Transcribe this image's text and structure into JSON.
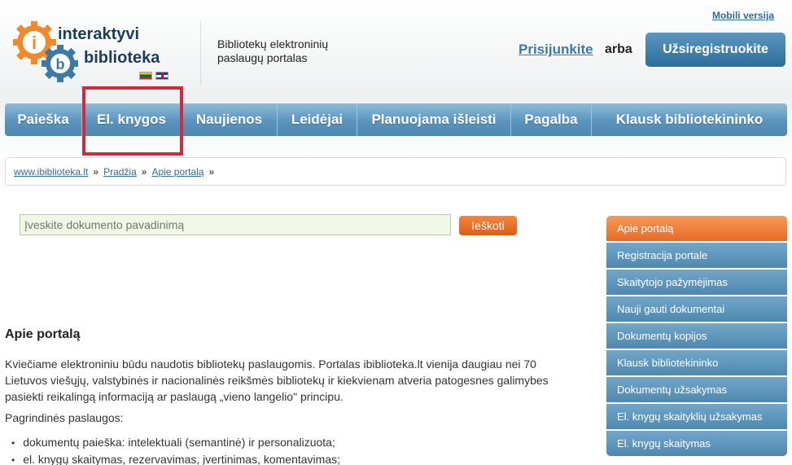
{
  "header": {
    "mobile_link": "Mobili versija",
    "logo_line1": "interaktyvi",
    "logo_line2": "biblioteka",
    "tagline": "Bibliotekų elektroninių paslaugų portalas",
    "login_link": "Prisijunkite",
    "or_text": "arba",
    "register_button": "Užsiregistruokite"
  },
  "nav": {
    "items": [
      {
        "label": "Paieška"
      },
      {
        "label": "El. knygos"
      },
      {
        "label": "Naujienos"
      },
      {
        "label": "Leidėjai"
      },
      {
        "label": "Planuojama išleisti"
      },
      {
        "label": "Pagalba"
      },
      {
        "label": "Klausk bibliotekininko"
      }
    ]
  },
  "breadcrumb": {
    "items": [
      "www.ibiblioteka.lt",
      "Pradžia",
      "Apie portalą"
    ],
    "separator": "»"
  },
  "search": {
    "placeholder": "Įveskite dokumento pavadinimą",
    "button": "Ieškoti"
  },
  "content": {
    "title": "Apie portalą",
    "intro": "Kviečiame elektroniniu būdu naudotis bibliotekų paslaugomis. Portalas ibiblioteka.lt vienija daugiau nei 70 Lietuvos viešųjų, valstybinės ir nacionalinės reikšmės bibliotekų ir kiekvienam atveria patogesnes galimybes pasiekti reikalingą informaciją ar paslaugą „vieno langelio\" principu.",
    "services_title": "Pagrindinės paslaugos:",
    "services": [
      "dokumentų paieška: intelektuali (semantinė) ir personalizuota;",
      "el. knygų skaitymas, rezervavimas, įvertinimas, komentavimas;"
    ]
  },
  "sidebar": {
    "items": [
      {
        "label": "Apie portalą",
        "active": true
      },
      {
        "label": "Registracija portale"
      },
      {
        "label": "Skaitytojo pažymėjimas"
      },
      {
        "label": "Nauji gauti dokumentai"
      },
      {
        "label": "Dokumentų kopijos"
      },
      {
        "label": "Klausk bibliotekininko"
      },
      {
        "label": "Dokumentų užsakymas"
      },
      {
        "label": "El. knygų skaityklių užsakymas"
      },
      {
        "label": "El. knygų skaitymas"
      }
    ]
  },
  "colors": {
    "nav_blue": "#5a94bd",
    "accent_orange": "#ea6a23",
    "highlight_red": "#d9263a",
    "link_blue": "#2f6d99"
  }
}
